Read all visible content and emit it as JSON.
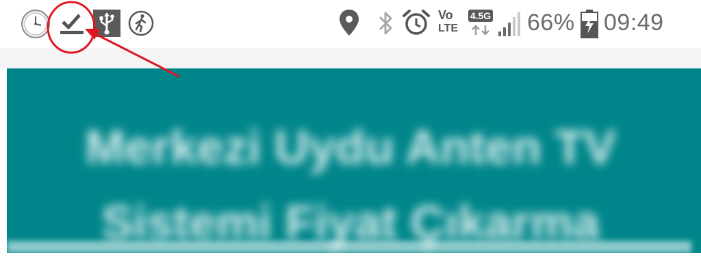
{
  "status_bar": {
    "battery_percent": "66%",
    "battery_level": 0.66,
    "time": "09:49",
    "volte_top": "Vo",
    "volte_bottom": "LTE",
    "network_type": "4.5G",
    "icons": [
      "clock-app-icon",
      "download-complete-icon",
      "usb-icon",
      "pedometer-icon",
      "location-icon",
      "bluetooth-icon",
      "alarm-icon",
      "volte-icon",
      "network-data-icon",
      "signal-icon",
      "battery-charging-icon"
    ],
    "icon_color": "#6b6b6b"
  },
  "content": {
    "title_line1": "Merkezi Uydu Anten TV",
    "title_line2": "Sistemi Fiyat Çıkarma",
    "header_color": "#00868a"
  },
  "annotation": {
    "color": "#e0161f"
  }
}
